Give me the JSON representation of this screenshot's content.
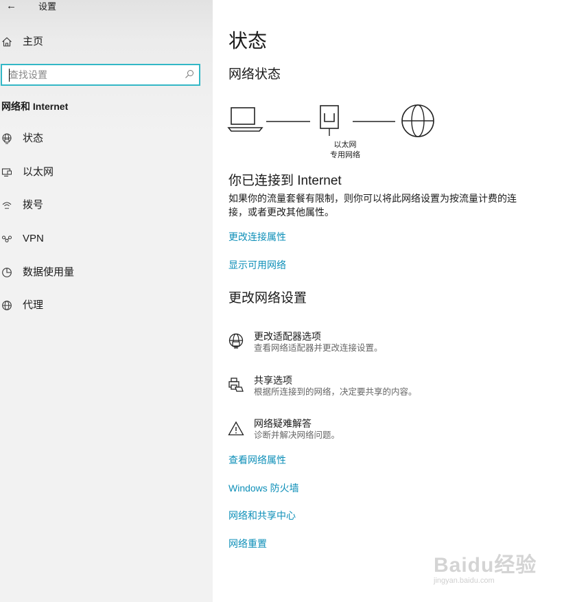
{
  "window": {
    "title": "设置",
    "back_glyph": "←"
  },
  "sidebar": {
    "home_label": "主页",
    "search": {
      "placeholder": "查找设置",
      "value": ""
    },
    "section_title": "网络和 Internet",
    "items": [
      {
        "label": "状态",
        "icon": "globe-monitor-icon"
      },
      {
        "label": "以太网",
        "icon": "ethernet-monitor-icon"
      },
      {
        "label": "拨号",
        "icon": "dialup-icon"
      },
      {
        "label": "VPN",
        "icon": "vpn-icon"
      },
      {
        "label": "数据使用量",
        "icon": "data-usage-icon"
      },
      {
        "label": "代理",
        "icon": "globe-icon"
      }
    ]
  },
  "main": {
    "title": "状态",
    "network_status_heading": "网络状态",
    "diagram": {
      "adapter_name": "以太网",
      "network_type": "专用网络"
    },
    "connected_title": "你已连接到 Internet",
    "connected_desc": "如果你的流量套餐有限制，则你可以将此网络设置为按流量计费的连接，或者更改其他属性。",
    "links_top": [
      "更改连接属性",
      "显示可用网络"
    ],
    "change_settings_heading": "更改网络设置",
    "options": [
      {
        "title": "更改适配器选项",
        "desc": "查看网络适配器并更改连接设置。",
        "icon": "adapter-globe-icon"
      },
      {
        "title": "共享选项",
        "desc": "根据所连接到的网络，决定要共享的内容。",
        "icon": "sharing-printer-icon"
      },
      {
        "title": "网络疑难解答",
        "desc": "诊断并解决网络问题。",
        "icon": "warning-triangle-icon"
      }
    ],
    "links_bottom": [
      "查看网络属性",
      "Windows 防火墙",
      "网络和共享中心",
      "网络重置"
    ]
  },
  "watermark": {
    "brand": "Baidu经验",
    "url": "jingyan.baidu.com"
  },
  "colors": {
    "accent": "#0e8fb8",
    "search_border": "#32b7c6",
    "sidebar_bg": "#f2f2f2"
  }
}
